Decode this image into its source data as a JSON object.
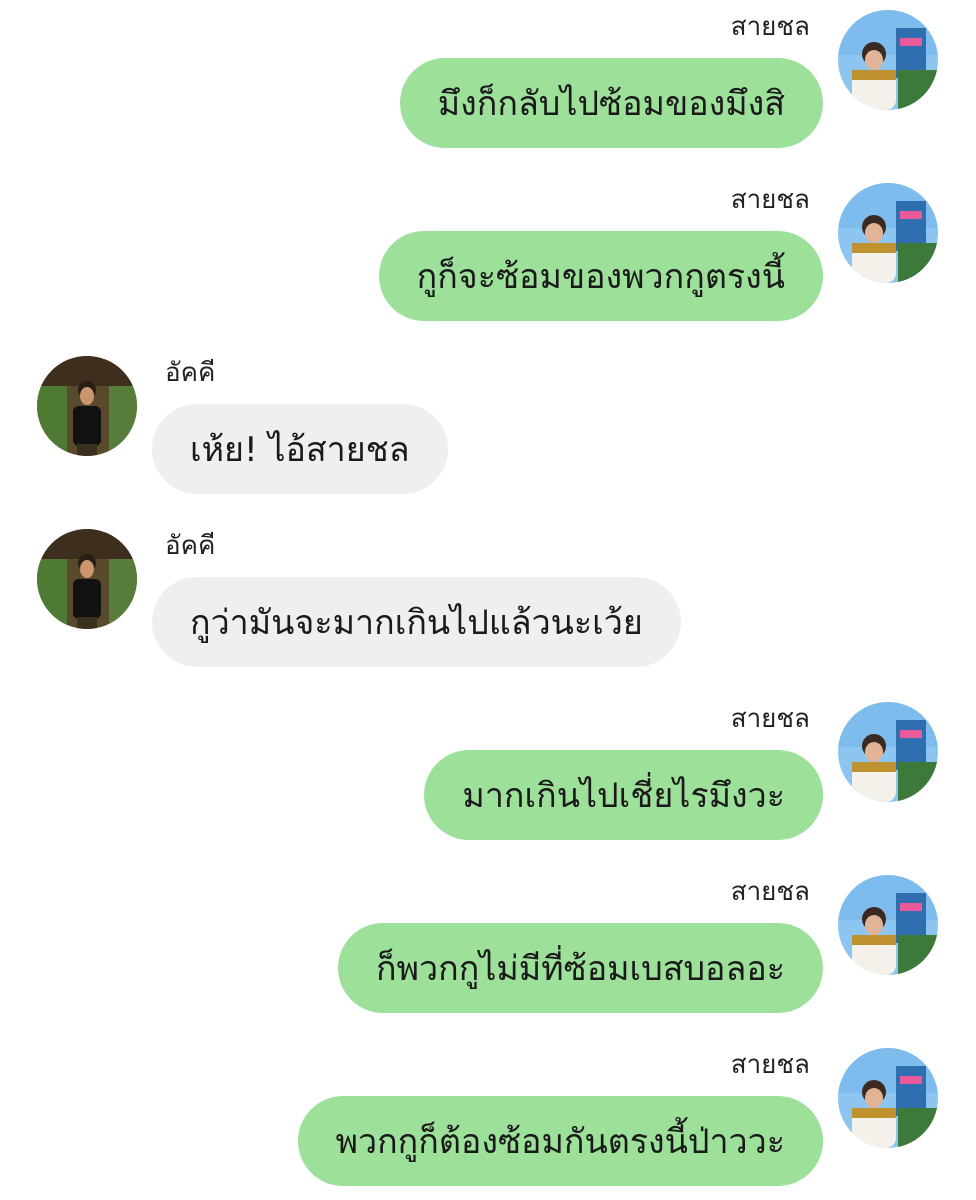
{
  "colors": {
    "outgoing_bubble": "#9de09a",
    "incoming_bubble": "#efefef",
    "background": "#ffffff"
  },
  "messages": [
    {
      "side": "right",
      "sender": "สายชล",
      "text": "มึงก็กลับไปซ้อมของมึงสิ",
      "avatar": "avatar-saichon"
    },
    {
      "side": "right",
      "sender": "สายชล",
      "text": "กูก็จะซ้อมของพวกกูตรงนี้",
      "avatar": "avatar-saichon"
    },
    {
      "side": "left",
      "sender": "อัคคี",
      "text": "เห้ย! ไอ้สายชล",
      "avatar": "avatar-akkhi"
    },
    {
      "side": "left",
      "sender": "อัคคี",
      "text": "กูว่ามันจะมากเกินไปแล้วนะเว้ย",
      "avatar": "avatar-akkhi"
    },
    {
      "side": "right",
      "sender": "สายชล",
      "text": "มากเกินไปเชี่ยไรมึงวะ",
      "avatar": "avatar-saichon"
    },
    {
      "side": "right",
      "sender": "สายชล",
      "text": "ก็พวกกูไม่มีที่ซ้อมเบสบอลอะ",
      "avatar": "avatar-saichon"
    },
    {
      "side": "right",
      "sender": "สายชล",
      "text": "พวกกูก็ต้องซ้อมกันตรงนี้ป่าววะ",
      "avatar": "avatar-saichon"
    }
  ]
}
